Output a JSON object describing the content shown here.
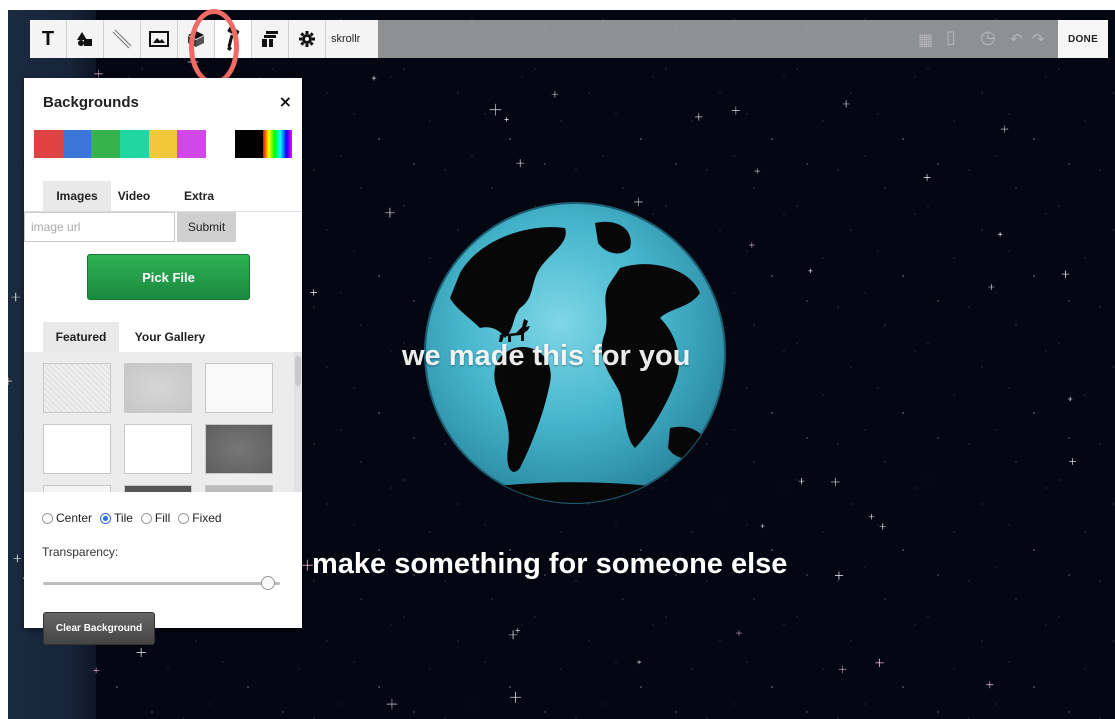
{
  "toolbar": {
    "tools": [
      {
        "name": "text-tool",
        "icon": "text-icon",
        "glyph": "T"
      },
      {
        "name": "shapes-tool",
        "icon": "shapes-icon"
      },
      {
        "name": "line-tool",
        "icon": "line-icon"
      },
      {
        "name": "image-tool",
        "icon": "image-icon"
      },
      {
        "name": "3d-tool",
        "icon": "cube-icon"
      },
      {
        "name": "background-tool",
        "icon": "paint-roller-icon"
      },
      {
        "name": "layers-tool",
        "icon": "layers-icon"
      },
      {
        "name": "settings-tool",
        "icon": "gear-icon"
      }
    ],
    "skrollr_label": "skrollr",
    "done_label": "DONE"
  },
  "canvas": {
    "headline": "we made this for you",
    "subline": "make something for someone else"
  },
  "panel": {
    "title": "Backgrounds",
    "close": "×",
    "swatches": [
      "#e04242",
      "#3a77d8",
      "#36b34a",
      "#22d6a2",
      "#f1c83a",
      "#d148e8",
      "#ffffff",
      "#000000",
      "rainbow"
    ],
    "tabs": [
      "Images",
      "Video",
      "Extra"
    ],
    "active_tab": "Images",
    "image_url_placeholder": "image url",
    "submit_label": "Submit",
    "pick_file_label": "Pick File",
    "gallery_tabs": [
      "Featured",
      "Your Gallery"
    ],
    "active_gallery_tab": "Featured",
    "position_options": [
      "Center",
      "Tile",
      "Fill",
      "Fixed"
    ],
    "selected_position": "Tile",
    "transparency_label": "Transparency:",
    "transparency_value": 0.95,
    "clear_label": "Clear Background"
  },
  "colors": {
    "accent_ring": "#f06a66",
    "pick_file_green": "#1f9a46",
    "space": "#040612"
  }
}
